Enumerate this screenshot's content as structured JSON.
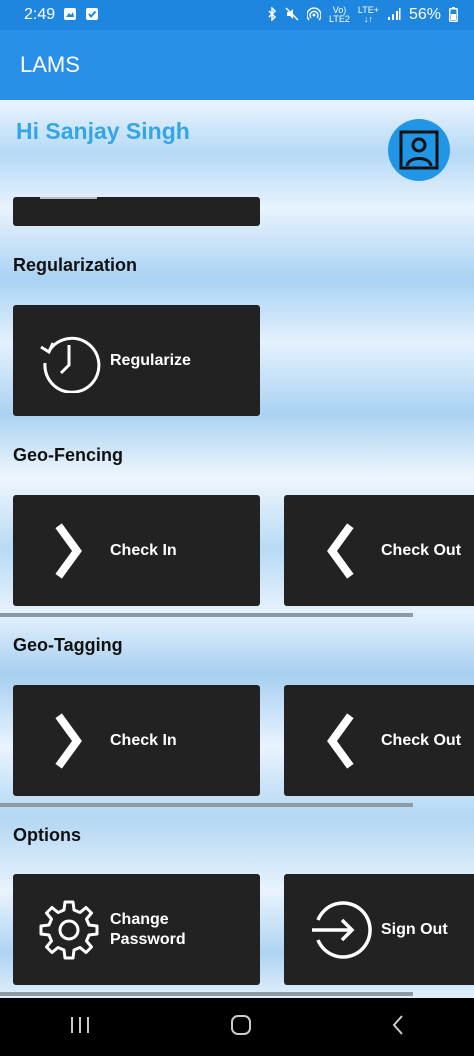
{
  "status_bar": {
    "time": "2:49",
    "signal_top": "Vo)",
    "signal_bottom": "LTE2",
    "lte_top": "LTE+",
    "battery": "56%"
  },
  "app_bar": {
    "title": "LAMS"
  },
  "greeting": "Hi Sanjay Singh",
  "sections": {
    "regularization": "Regularization",
    "geo_fencing": "Geo-Fencing",
    "geo_tagging": "Geo-Tagging",
    "options": "Options"
  },
  "buttons": {
    "regularize": "Regularize",
    "fence_check_in": "Check In",
    "fence_check_out": "Check Out",
    "tag_check_in": "Check In",
    "tag_check_out": "Check Out",
    "change_password_line1": "Change",
    "change_password_line2": "Password",
    "sign_out": "Sign Out"
  },
  "colors": {
    "accent": "#2990e8",
    "greeting": "#33a6e8",
    "card": "#222222"
  },
  "icons": {
    "regularize": "history-clock-icon",
    "check_in": "chevron-right-icon",
    "check_out": "chevron-left-icon",
    "change_password": "gear-icon",
    "sign_out": "sign-out-icon",
    "avatar": "profile-icon"
  }
}
